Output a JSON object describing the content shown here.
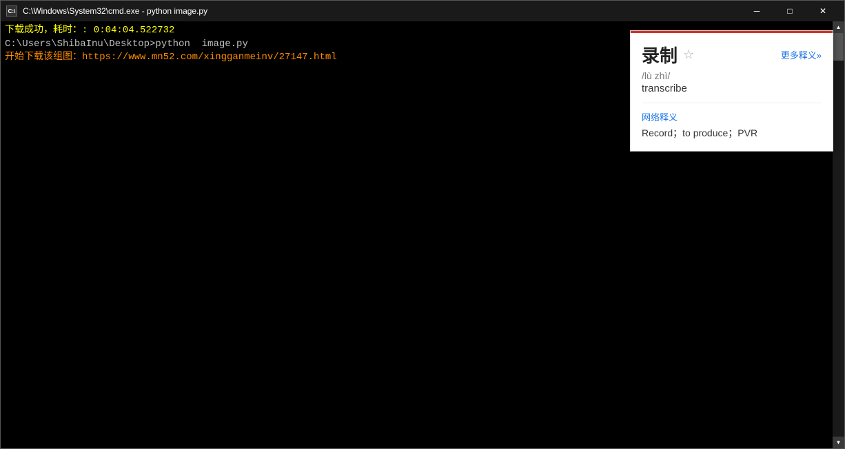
{
  "titlebar": {
    "icon_label": "C:\\",
    "title": "C:\\Windows\\System32\\cmd.exe - python  image.py",
    "minimize_label": "─",
    "maximize_label": "□",
    "close_label": "✕"
  },
  "terminal": {
    "lines": [
      {
        "text": "下载成功，耗时：: 0:04:04.522732",
        "style": "yellow"
      },
      {
        "text": "",
        "style": "white"
      },
      {
        "text": "C:\\Users\\ShibaInu\\Desktop>python  image.py",
        "style": "white"
      },
      {
        "text": "开始下载该组图：https://www.mn52.com/xingganmeinv/27147.html",
        "style": "cyan"
      }
    ]
  },
  "popup": {
    "word": "录制",
    "star": "☆",
    "more_label": "更多释义»",
    "pinyin": "/lù zhì/",
    "meaning": "transcribe",
    "network_label": "网络释义",
    "network_meaning": "Record；to produce；PVR"
  }
}
